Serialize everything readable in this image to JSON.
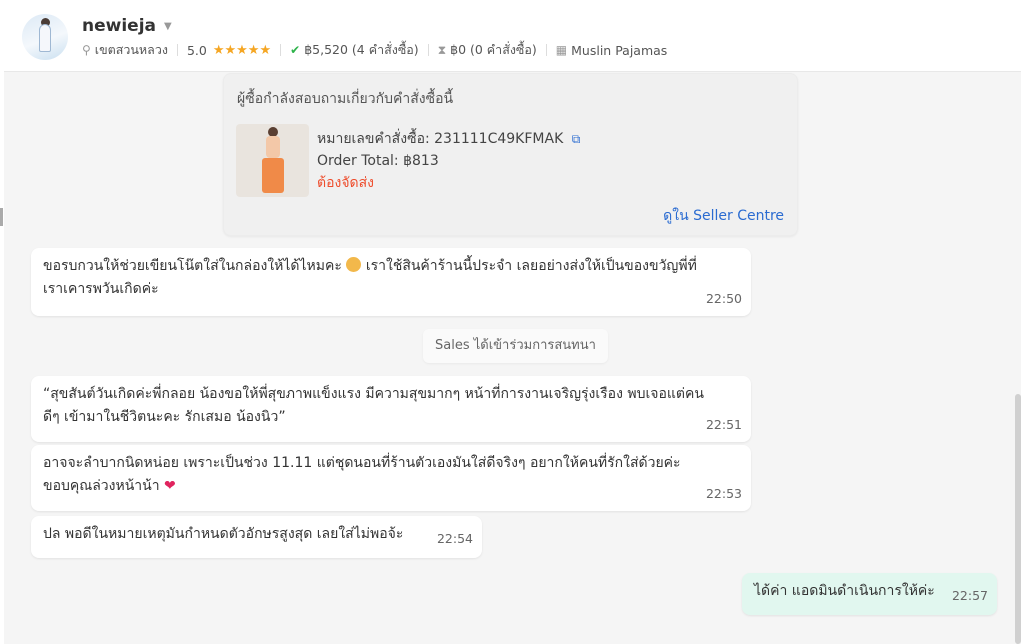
{
  "header": {
    "shop_name": "newieja",
    "location": "เขตสวนหลวง",
    "rating": "5.0",
    "stars": "★★★★★",
    "paid": "฿5,520 (4 คำสั่งซื้อ)",
    "unpaid": "฿0 (0 คำสั่งซื้อ)",
    "category": "Muslin Pajamas",
    "accent_color": "#ee4d2d"
  },
  "order_card": {
    "title": "ผู้ซื้อกำลังสอบถามเกี่ยวกับคำสั่งซื้อนี้",
    "order_number": "หมายเลขคำสั่งซื้อ: 231111C49KFMAK",
    "order_total": "Order Total: ฿813",
    "status": "ต้องจัดส่ง",
    "link": "ดูใน Seller Centre"
  },
  "messages": [
    {
      "line1": "ขอรบกวนให้ช่วยเขียนโน๊ตใส่ในกล่องให้ได้ไหมคะ",
      "line1b": "เราใช้สินค้าร้านนี้ประจำ เลยอย่างส่งให้เป็นของขวัญพี่ที่",
      "line2": "เราเคารพวันเกิดค่ะ",
      "time": "22:50"
    },
    {
      "line1": "“สุขสันต์วันเกิดค่ะพี่กลอย น้องขอให้พี่สุขภาพแข็งแรง มีความสุขมากๆ หน้าที่การงานเจริญรุ่งเรือง พบเจอแต่คน",
      "line2": "ดีๆ เข้ามาในชีวิตนะคะ รักเสมอ น้องนิว”",
      "time": "22:51"
    },
    {
      "line1": "อาจจะลำบากนิดหน่อย เพราะเป็นช่วง 11.11  แต่ชุดนอนที่ร้านตัวเองมันใส่ดีจริงๆ อยากให้คนที่รักใส่ด้วยค่ะ",
      "line2": "ขอบคุณล่วงหน้าน้า",
      "time": "22:53"
    },
    {
      "line1": "ปล พอดีในหมายเหตุมันกำหนดตัวอักษรสูงสุด เลยใส่ไม่พอจ้ะ",
      "time": "22:54"
    },
    {
      "line1": "ได้ค่า แอดมินดำเนินการให้ค่ะ",
      "time": "22:57"
    }
  ],
  "system_message": "Sales ได้เข้าร่วมการสนทนา"
}
